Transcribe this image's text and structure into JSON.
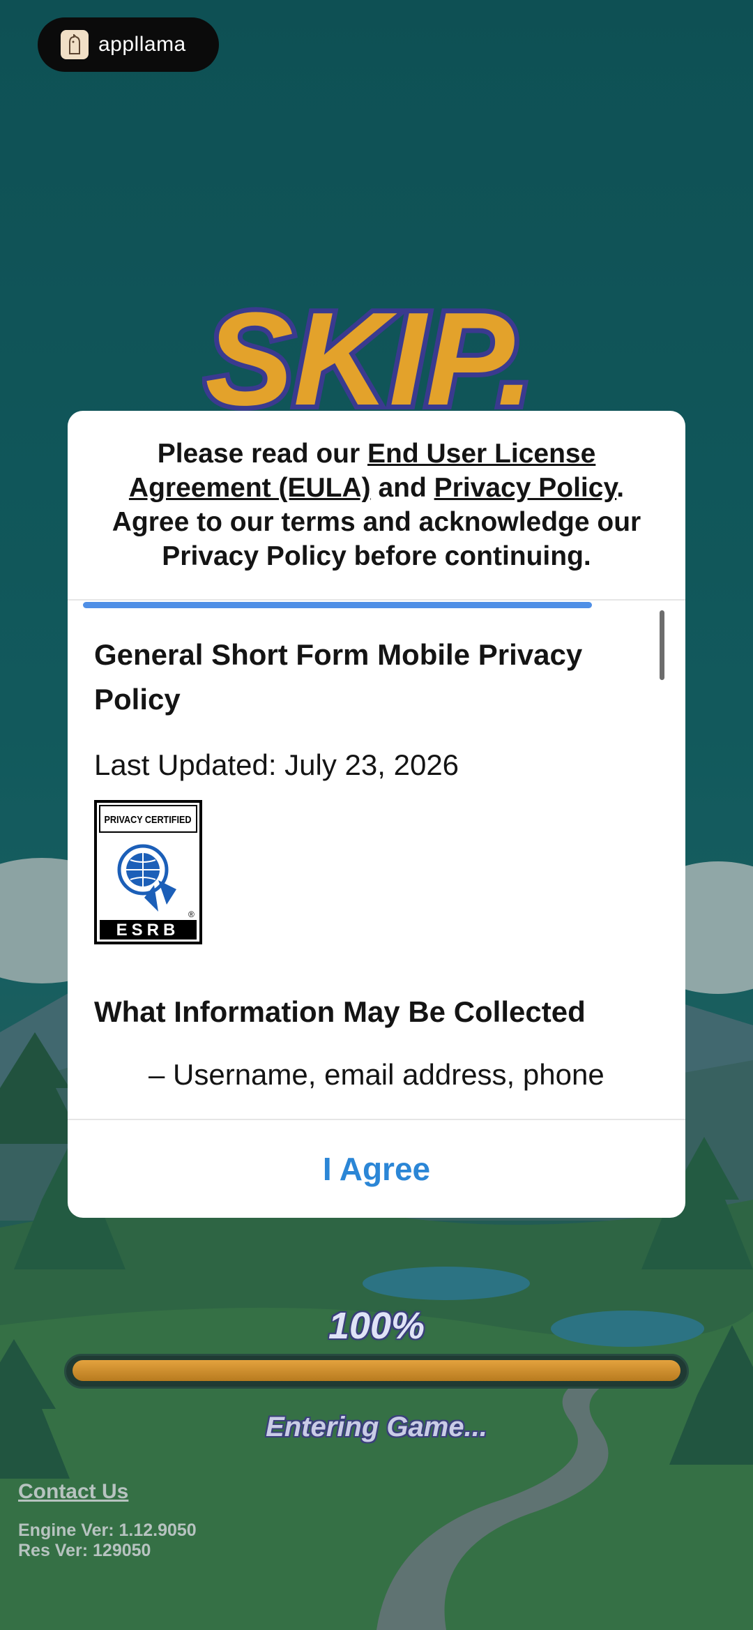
{
  "overlay": {
    "brand": "appllama"
  },
  "game": {
    "title": "SKIP."
  },
  "modal": {
    "intro_pre": "Please read our ",
    "eula_link": "End User License Agreement (EULA)",
    "intro_mid": " and ",
    "privacy_link": "Privacy Policy",
    "intro_post": ". Agree to our terms and acknowledge our Privacy Policy before continuing.",
    "policy_title": "General Short Form Mobile Privacy Policy",
    "last_updated": "Last Updated: July 23, 2026",
    "esrb_badge": {
      "top": "PRIVACY CERTIFIED",
      "bottom": "ESRB"
    },
    "section_heading": "What Information May Be Collected",
    "bullet_1": "– Username, email address, phone",
    "agree_button": "I Agree",
    "accent_color": "#2b86d6"
  },
  "loading": {
    "percent": "100%",
    "progress": 1.0,
    "status": "Entering Game..."
  },
  "footer": {
    "contact": "Contact Us",
    "engine_version": "Engine Ver: 1.12.9050",
    "res_version": "Res Ver: 129050"
  }
}
